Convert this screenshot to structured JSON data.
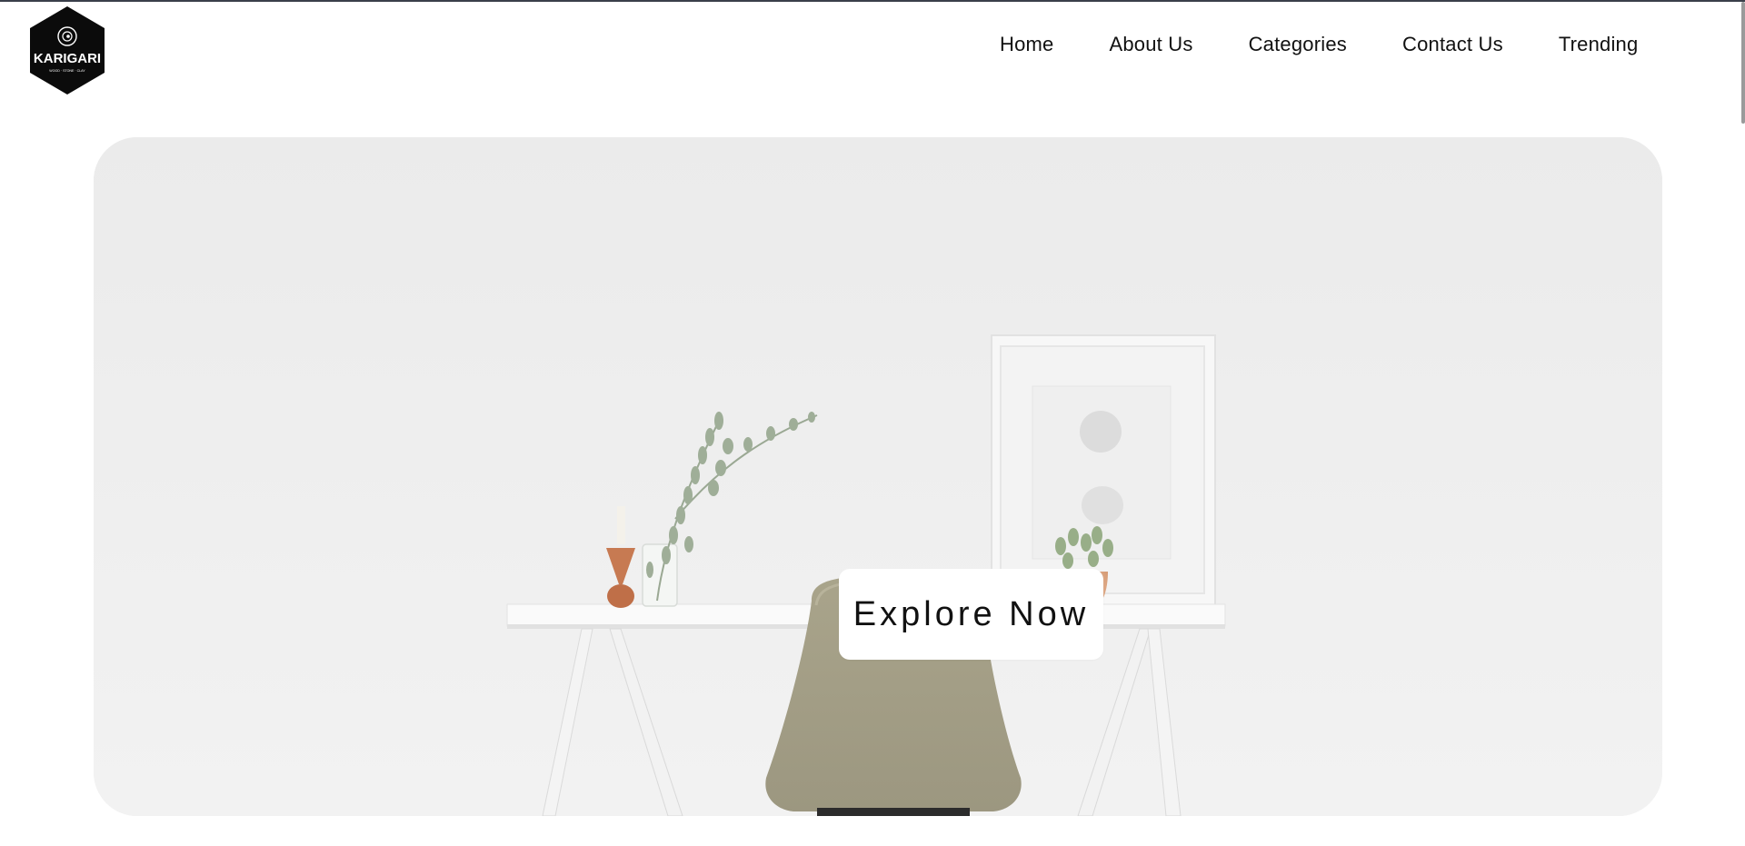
{
  "brand": {
    "name": "KARIGARI",
    "tagline": "WOOD · STONE · CLAY"
  },
  "nav": {
    "items": [
      {
        "label": "Home"
      },
      {
        "label": "About Us"
      },
      {
        "label": "Categories"
      },
      {
        "label": "Contact Us"
      },
      {
        "label": "Trending"
      }
    ]
  },
  "hero": {
    "cta_label": "Explore Now"
  },
  "colors": {
    "topline": "#3a3f4a",
    "background": "#ffffff",
    "hero_background": "#eeeeee",
    "chair": "#a8a287"
  }
}
